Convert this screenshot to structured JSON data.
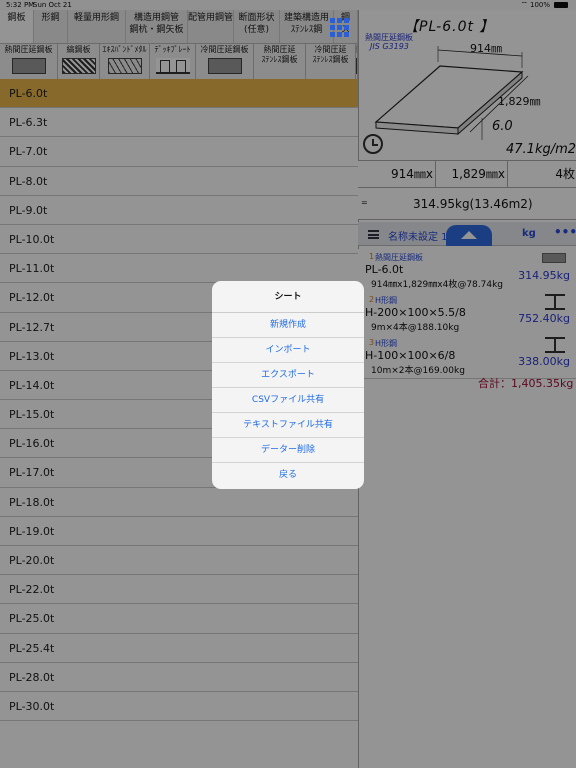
{
  "status": {
    "time": "5:32 PM",
    "date": "Sun Oct 21",
    "battery": "100%",
    "battery_level": 1.0,
    "wifi_icon": "wifi-icon"
  },
  "categories": [
    {
      "label": "鋼板",
      "active": true
    },
    {
      "label": "形鋼"
    },
    {
      "label": "軽量用形鋼"
    },
    {
      "label": "構造用鋼管\n鋼杭・鋼矢板"
    },
    {
      "label": "配管用鋼管"
    },
    {
      "label": "断面形状\n(任意)"
    },
    {
      "label": "建築構造用\nｽﾃﾝﾚｽ鋼"
    },
    {
      "label": "鋼\nス"
    }
  ],
  "subcategories": [
    {
      "label": "熱間圧延鋼板",
      "icon": "plate-icon"
    },
    {
      "label": "縞鋼板",
      "icon": "checkered-plate-icon"
    },
    {
      "label": "ｴｷｽﾊﾟﾝﾄﾞﾒﾀﾙ",
      "icon": "expanded-metal-icon"
    },
    {
      "label": "ﾃﾞｯｷﾌﾟﾚｰﾄ",
      "icon": "deck-plate-icon"
    },
    {
      "label": "冷間圧延鋼板",
      "icon": "plate-icon"
    },
    {
      "label": "熱間圧延\nｽﾃﾝﾚｽ鋼板",
      "icon": "plate-icon"
    },
    {
      "label": "冷間圧延\nｽﾃﾝﾚｽ鋼板",
      "icon": "plate-icon"
    },
    {
      "label": "円",
      "icon": "plate-icon"
    }
  ],
  "thickness_list": [
    "PL-6.0t",
    "PL-6.3t",
    "PL-7.0t",
    "PL-8.0t",
    "PL-9.0t",
    "PL-10.0t",
    "PL-11.0t",
    "PL-12.0t",
    "PL-12.7t",
    "PL-13.0t",
    "PL-14.0t",
    "PL-15.0t",
    "PL-16.0t",
    "PL-17.0t",
    "PL-18.0t",
    "PL-19.0t",
    "PL-20.0t",
    "PL-22.0t",
    "PL-25.0t",
    "PL-25.4t",
    "PL-28.0t",
    "PL-30.0t"
  ],
  "selected_index": 0,
  "detail": {
    "title": "【PL-6.0t 】",
    "standard_name": "熱間圧延鋼板",
    "standard_code": "JIS G3193",
    "width_label": "914㎜",
    "length_label": "1,829㎜",
    "thickness_label": "6.0",
    "unit_weight": "47.1kg/m2",
    "inputs": [
      "914㎜x",
      "1,829㎜x",
      "4枚"
    ],
    "result_prefix": "=",
    "result": "314.95kg(13.46m2)"
  },
  "sheet": {
    "name": "名称未設定 1",
    "unit": "kg",
    "more": "•••"
  },
  "items": [
    {
      "num": "1",
      "category": "熱間圧延鋼板",
      "name": "PL-6.0t",
      "detail": "914㎜x1,829㎜x4枚@78.74kg",
      "weight": "314.95kg",
      "icon": "plate-icon"
    },
    {
      "num": "2",
      "category": "H形鋼",
      "name": "H-200×100×5.5/8",
      "detail": "9m×4本@188.10kg",
      "weight": "752.40kg",
      "icon": "h-beam-icon"
    },
    {
      "num": "3",
      "category": "H形鋼",
      "name": "H-100×100×6/8",
      "detail": "10m×2本@169.00kg",
      "weight": "338.00kg",
      "icon": "h-beam-icon"
    }
  ],
  "total": "合計：1,405.35kg",
  "dialog": {
    "title": "シート",
    "options": [
      "新規作成",
      "インポート",
      "エクスポート",
      "CSVファイル共有",
      "テキストファイル共有",
      "データー削除",
      "戻る"
    ]
  }
}
